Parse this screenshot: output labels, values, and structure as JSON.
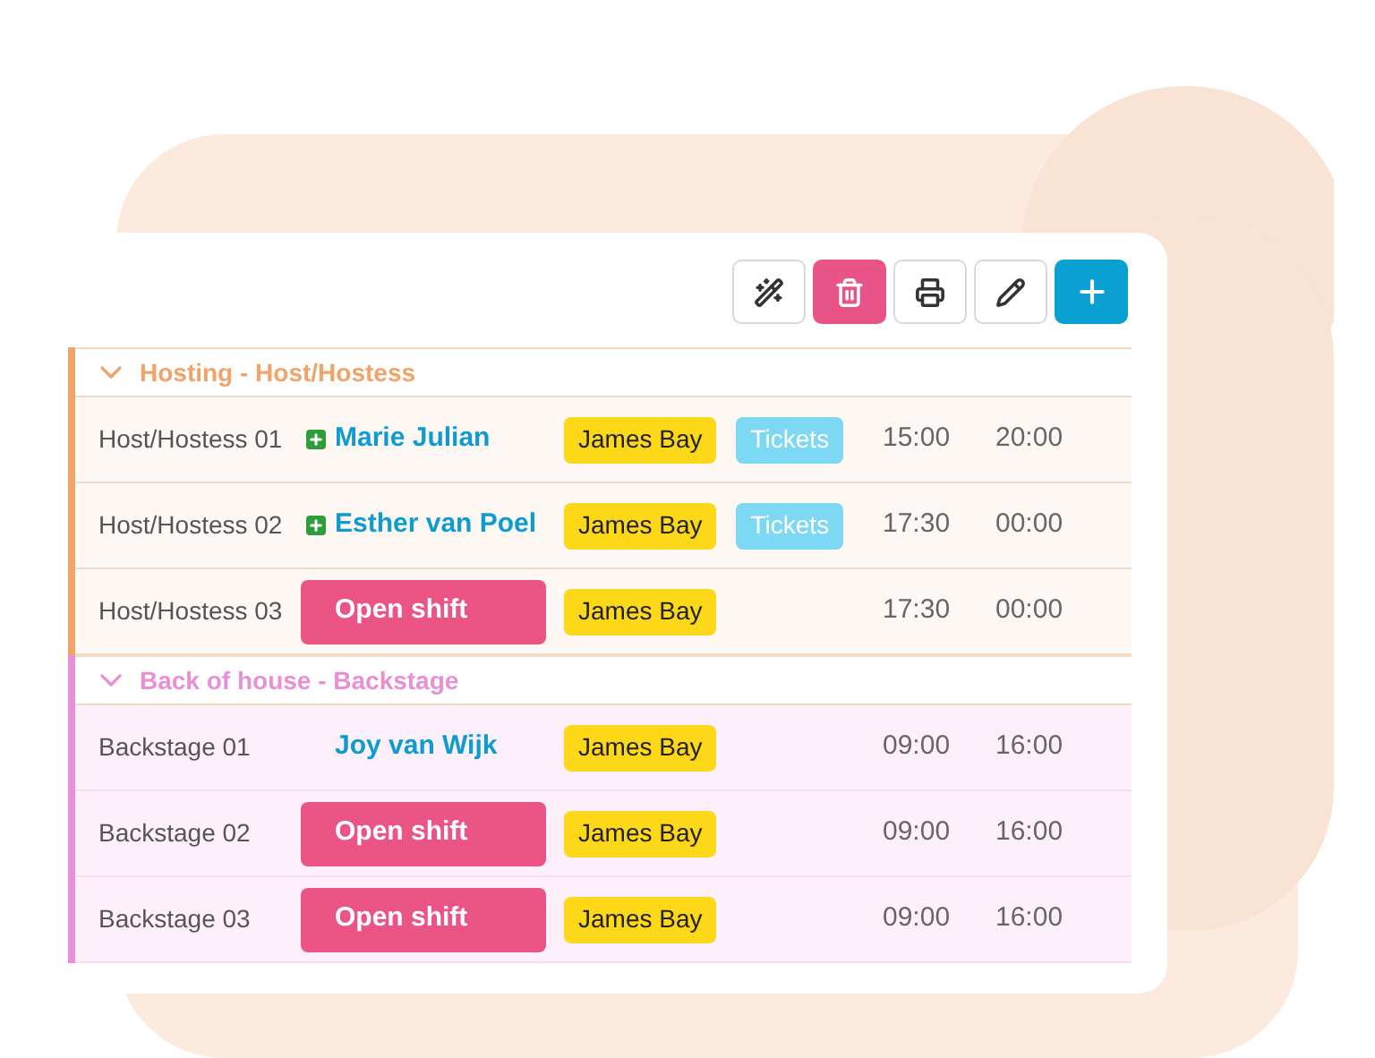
{
  "toolbar": [
    {
      "kind": "magic"
    },
    {
      "kind": "delete"
    },
    {
      "kind": "print"
    },
    {
      "kind": "edit"
    },
    {
      "kind": "add"
    }
  ],
  "groups": [
    {
      "title": "Hosting - Host/Hostess",
      "color": "#f0a46a",
      "expanded": true,
      "rows": [
        {
          "position": "Host/Hostess 01",
          "kind": "assigned",
          "added": true,
          "person": "Marie Julian",
          "tags": [
            {
              "kind": "location",
              "label": "James Bay"
            },
            {
              "kind": "label",
              "label": "Tickets"
            }
          ],
          "start": "15:00",
          "end": "20:00"
        },
        {
          "position": "Host/Hostess 02",
          "kind": "assigned",
          "added": true,
          "person": "Esther van Poel",
          "tags": [
            {
              "kind": "location",
              "label": "James Bay"
            },
            {
              "kind": "label",
              "label": "Tickets"
            }
          ],
          "start": "17:30",
          "end": "00:00"
        },
        {
          "position": "Host/Hostess 03",
          "kind": "open",
          "person": "Open shift",
          "tags": [
            {
              "kind": "location",
              "label": "James Bay"
            }
          ],
          "start": "17:30",
          "end": "00:00"
        }
      ]
    },
    {
      "title": "Back of house - Backstage",
      "color": "#e98fd6",
      "expanded": true,
      "rows": [
        {
          "position": "Backstage 01",
          "kind": "assigned",
          "added": false,
          "person": "Joy van Wijk",
          "tags": [
            {
              "kind": "location",
              "label": "James Bay"
            }
          ],
          "start": "09:00",
          "end": "16:00"
        },
        {
          "position": "Backstage 02",
          "kind": "open",
          "person": "Open shift",
          "tags": [
            {
              "kind": "location",
              "label": "James Bay"
            }
          ],
          "start": "09:00",
          "end": "16:00"
        },
        {
          "position": "Backstage 03",
          "kind": "open",
          "person": "Open shift",
          "tags": [
            {
              "kind": "location",
              "label": "James Bay"
            }
          ],
          "start": "09:00",
          "end": "16:00"
        }
      ]
    }
  ]
}
